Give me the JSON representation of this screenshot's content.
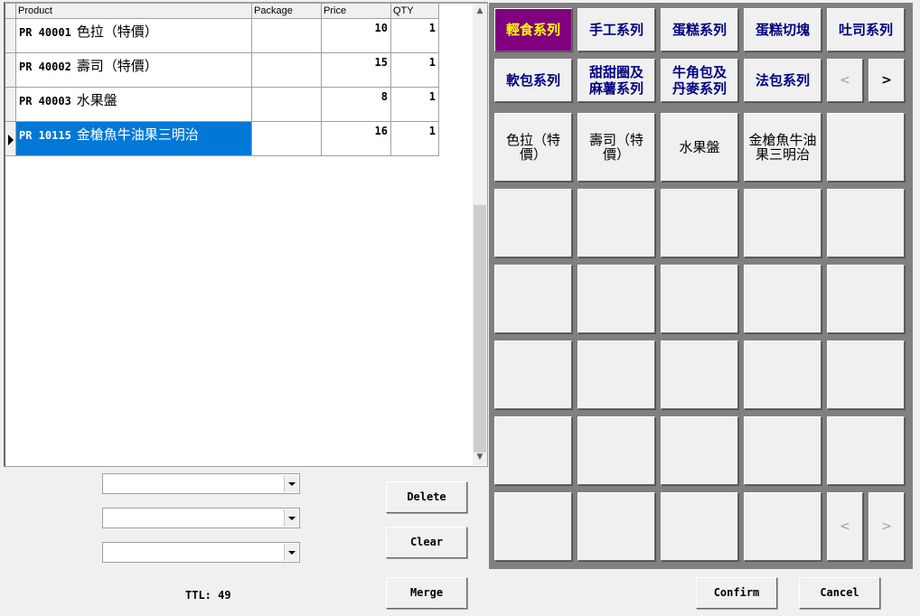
{
  "grid": {
    "columns": [
      "Product",
      "Package",
      "Price",
      "QTY"
    ],
    "rows": [
      {
        "code": "PR 40001",
        "name": "色拉（特價）",
        "package": "",
        "price": "10",
        "qty": "1",
        "selected": false
      },
      {
        "code": "PR 40002",
        "name": "壽司（特價）",
        "package": "",
        "price": "15",
        "qty": "1",
        "selected": false
      },
      {
        "code": "PR 40003",
        "name": "水果盤",
        "package": "",
        "price": "8",
        "qty": "1",
        "selected": false
      },
      {
        "code": "PR 10115",
        "name": "金槍魚牛油果三明治",
        "package": "",
        "price": "16",
        "qty": "1",
        "selected": true
      }
    ],
    "scroll_up_icon": "▲",
    "scroll_down_icon": "▼"
  },
  "combos": [
    {
      "value": ""
    },
    {
      "value": ""
    },
    {
      "value": ""
    }
  ],
  "buttons": {
    "delete": "Delete",
    "clear": "Clear",
    "merge": "Merge",
    "confirm": "Confirm",
    "cancel": "Cancel"
  },
  "total": {
    "label": "TTL: 49"
  },
  "categories": {
    "row1": [
      "輕食系列",
      "手工系列",
      "蛋糕系列",
      "蛋糕切塊",
      "吐司系列"
    ],
    "row2": [
      "軟包系列",
      "甜甜圈及\n麻薯系列",
      "牛角包及\n丹麥系列",
      "法包系列"
    ],
    "active": "輕食系列",
    "prev": "<",
    "next": ">"
  },
  "products": {
    "items": [
      "色拉（特\n價）",
      "壽司（特\n價）",
      "水果盤",
      "金槍魚牛油\n果三明治"
    ],
    "prev": "<",
    "next": ">"
  },
  "colors": {
    "active_category_bg": "#800080",
    "active_category_fg": "#ffff00",
    "category_fg": "#000080",
    "selection": "#0078d7",
    "panel_bg": "#808080"
  }
}
